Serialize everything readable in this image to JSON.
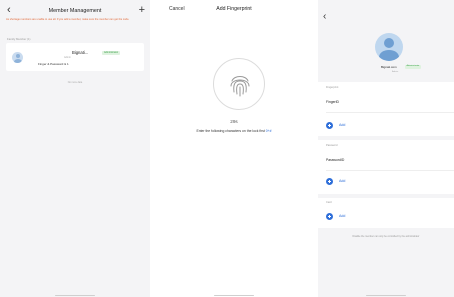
{
  "screen1": {
    "back_icon": "‹",
    "title": "Member Management",
    "add_icon": "+",
    "warning": "As shortage members are unable to use all. If you add a member, make sure the member can get the code.",
    "section_label": "Family Member (1)",
    "member": {
      "name": "Bignati...",
      "badge": "Administrator",
      "sub": "Admin",
      "keys": "Finger & Password & 1"
    },
    "footer": "No more data"
  },
  "screen2": {
    "cancel_label": "Cancel",
    "title": "Add Fingerprint",
    "timer": "29s",
    "instruction": "Enter the following characters on the lock first ",
    "code": "0+#"
  },
  "screen3": {
    "back_icon": "‹",
    "name": "Bignati.com",
    "badge": "Administrator",
    "sub": "Admin",
    "fingerprint": {
      "header": "Fingerprint",
      "item": "FingerID",
      "add_label": "Add"
    },
    "password": {
      "header": "Password",
      "item": "PasswordID",
      "add_label": "Add"
    },
    "card": {
      "header": "Card",
      "add_label": "Add"
    },
    "footer": "Disable the member can only be controlled by the administrator"
  },
  "colors": {
    "accent": "#2f6fd9",
    "warning": "#e26a3a",
    "badge_bg": "#dff2df",
    "badge_text": "#3aa04a"
  },
  "icons": [
    "chevron-left-icon",
    "plus-icon",
    "fingerprint-icon",
    "avatar-icon",
    "add-circle-icon"
  ]
}
